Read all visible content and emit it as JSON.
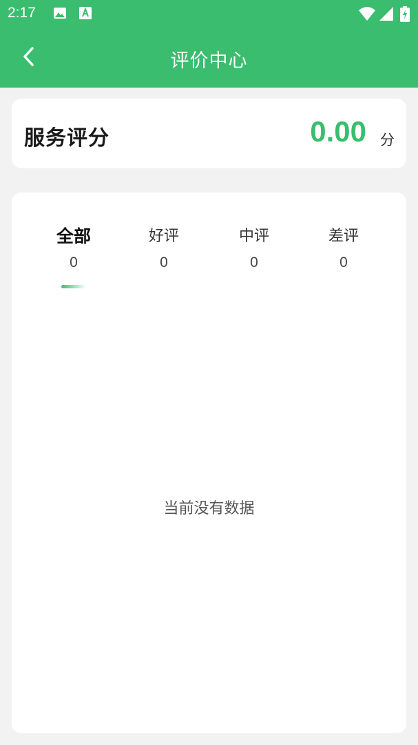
{
  "status_bar": {
    "time": "2:17"
  },
  "nav": {
    "title": "评价中心"
  },
  "score": {
    "label": "服务评分",
    "value": "0.00",
    "unit": "分"
  },
  "tabs": [
    {
      "label": "全部",
      "count": "0",
      "active": true
    },
    {
      "label": "好评",
      "count": "0",
      "active": false
    },
    {
      "label": "中评",
      "count": "0",
      "active": false
    },
    {
      "label": "差评",
      "count": "0",
      "active": false
    }
  ],
  "empty_state": {
    "text": "当前没有数据"
  },
  "colors": {
    "accent": "#3bbd6f",
    "background": "#f2f2f2",
    "card": "#ffffff"
  }
}
